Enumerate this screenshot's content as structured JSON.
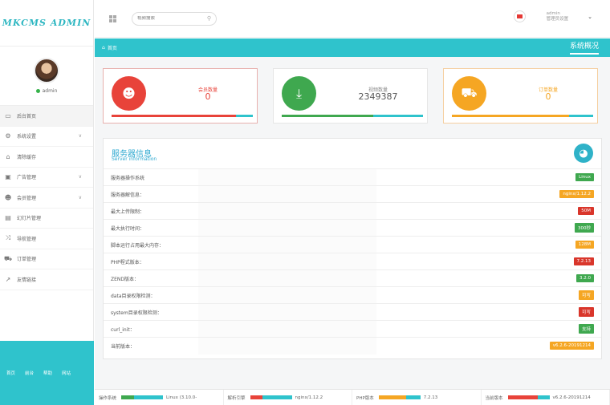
{
  "app": {
    "logo_text": "MKCMS ADMIN"
  },
  "profile": {
    "username": "admin"
  },
  "sidebar": {
    "items": [
      {
        "label": "后台首页",
        "icon": "monitor-icon",
        "chevron": false
      },
      {
        "label": "系统设置",
        "icon": "settings-icon",
        "chevron": true
      },
      {
        "label": "清除缓存",
        "icon": "home-icon",
        "chevron": false
      },
      {
        "label": "广告管理",
        "icon": "image-icon",
        "chevron": true
      },
      {
        "label": "会员管理",
        "icon": "users-icon",
        "chevron": true
      },
      {
        "label": "幻灯片管理",
        "icon": "slides-icon",
        "chevron": false
      },
      {
        "label": "导航管理",
        "icon": "shuffle-icon",
        "chevron": false
      },
      {
        "label": "订单管理",
        "icon": "cart-icon",
        "chevron": false
      },
      {
        "label": "友情链接",
        "icon": "link-icon",
        "chevron": false
      }
    ],
    "footer_links": [
      "首页",
      "前台",
      "帮助",
      "网站"
    ]
  },
  "topbar": {
    "search_placeholder": "视频搜索",
    "admin_name": "admin",
    "admin_role": "管理员设置"
  },
  "titlebar": {
    "home_label": "首页",
    "page_title": "系统概况"
  },
  "stats": [
    {
      "label": "会员数量",
      "value": "0",
      "color": "#e8433a",
      "icon": "users-icon",
      "progress": 0.88,
      "progress_color": "#e8433a"
    },
    {
      "label": "视频数量",
      "value": "2349387",
      "color": "#3fa84f",
      "icon": "download-icon",
      "progress": 0.65,
      "progress_color": "#3fa84f"
    },
    {
      "label": "订单数量",
      "value": "0",
      "color": "#f5a623",
      "icon": "cart-icon",
      "progress": 0.83,
      "progress_color": "#f5a623"
    }
  ],
  "server": {
    "title": "服务器信息",
    "subtitle": "Server information",
    "rows": [
      {
        "key": "服务器操作系统",
        "badge": "Linux",
        "color": "#3fa84f"
      },
      {
        "key": "服务器解信息：",
        "badge": "nginx/1.12.2",
        "color": "#f5a623"
      },
      {
        "key": "最大上传限制：",
        "badge": "50M",
        "color": "#d9362b"
      },
      {
        "key": "最大执行时间：",
        "badge": "300秒",
        "color": "#3fa84f"
      },
      {
        "key": "脚本运行占用最大内存：",
        "badge": "128M",
        "color": "#f5a623"
      },
      {
        "key": "PHP程式版本：",
        "badge": "7.2.13",
        "color": "#d9362b"
      },
      {
        "key": "ZEND版本：",
        "badge": "3.2.0",
        "color": "#3fa84f"
      },
      {
        "key": "data目录权限检测：",
        "badge": "可写",
        "color": "#f5a623"
      },
      {
        "key": "system目录权限检测：",
        "badge": "可写",
        "color": "#d9362b"
      },
      {
        "key": "curl_init：",
        "badge": "支持",
        "color": "#3fa84f"
      },
      {
        "key": "当前版本：",
        "badge": "v6.2.6-20191214",
        "color": "#f5a623"
      }
    ]
  },
  "footer": [
    {
      "label": "操作系统",
      "value": "Linux (3.10.0-",
      "fill": 0.3,
      "color": "#3fa84f"
    },
    {
      "label": "解析引擎",
      "value": "nginx/1.12.2",
      "fill": 0.3,
      "color": "#e8433a"
    },
    {
      "label": "PHP版本",
      "value": "7.2.13",
      "fill": 0.65,
      "color": "#f5a623"
    },
    {
      "label": "当前版本",
      "value": "v6.2.6-20191214",
      "fill": 0.72,
      "color": "#e8433a"
    }
  ]
}
